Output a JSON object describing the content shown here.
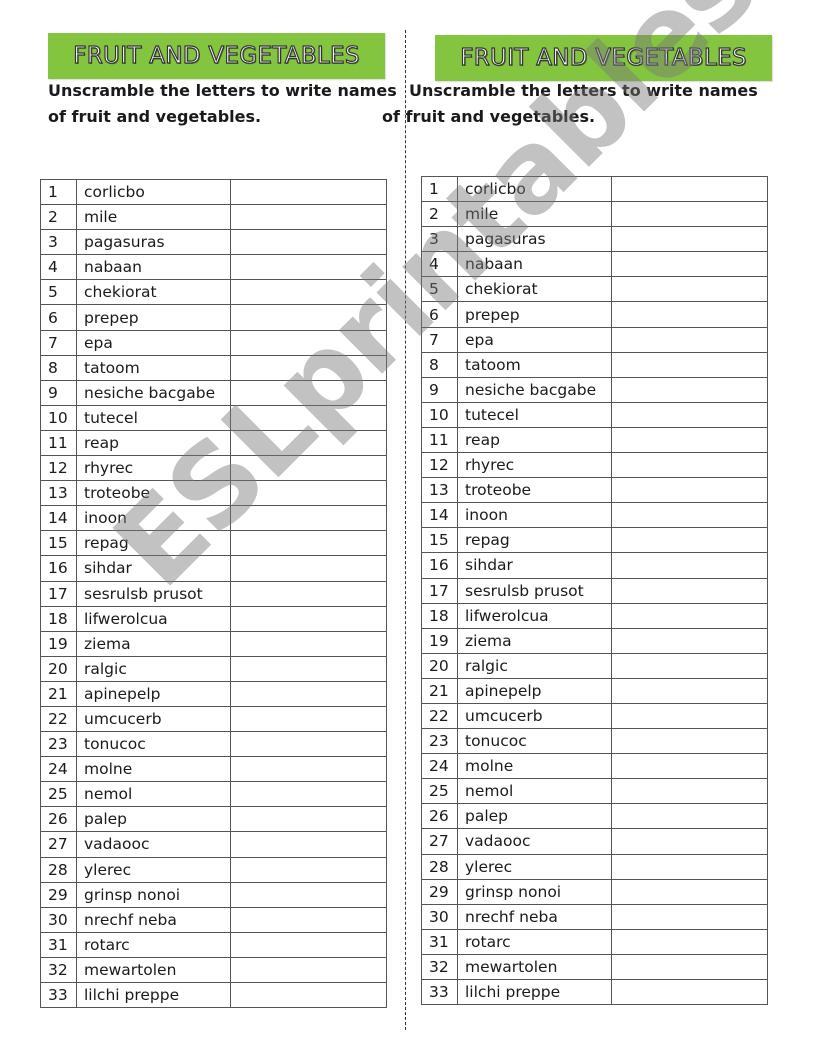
{
  "worksheet": {
    "title": "FRUIT AND VEGETABLES",
    "instruction_line1": "Unscramble the letters to write names",
    "instruction_line2": "of fruit and vegetables.",
    "accent_color": "#84c53f",
    "watermark": "ESLprintables.com",
    "items": [
      {
        "num": "1",
        "word": "corlicbo"
      },
      {
        "num": "2",
        "word": "mile"
      },
      {
        "num": "3",
        "word": "pagasuras"
      },
      {
        "num": "4",
        "word": "nabaan"
      },
      {
        "num": "5",
        "word": "chekiorat"
      },
      {
        "num": "6",
        "word": "prepep"
      },
      {
        "num": "7",
        "word": "epa"
      },
      {
        "num": "8",
        "word": "tatoom"
      },
      {
        "num": "9",
        "word": "nesiche bacgabe"
      },
      {
        "num": "10",
        "word": "tutecel"
      },
      {
        "num": "11",
        "word": "reap"
      },
      {
        "num": "12",
        "word": "rhyrec"
      },
      {
        "num": "13",
        "word": "troteobe"
      },
      {
        "num": "14",
        "word": "inoon"
      },
      {
        "num": "15",
        "word": "repag"
      },
      {
        "num": "16",
        "word": "sihdar"
      },
      {
        "num": "17",
        "word": "sesrulsb prusot"
      },
      {
        "num": "18",
        "word": "lifwerolcua"
      },
      {
        "num": "19",
        "word": "ziema"
      },
      {
        "num": "20",
        "word": "ralgic"
      },
      {
        "num": "21",
        "word": "apinepelp"
      },
      {
        "num": "22",
        "word": "umcucerb"
      },
      {
        "num": "23",
        "word": "tonucoc"
      },
      {
        "num": "24",
        "word": "molne"
      },
      {
        "num": "25",
        "word": "nemol"
      },
      {
        "num": "26",
        "word": "palep"
      },
      {
        "num": "27",
        "word": "vadaooc"
      },
      {
        "num": "28",
        "word": "ylerec"
      },
      {
        "num": "29",
        "word": "grinsp nonoi"
      },
      {
        "num": "30",
        "word": "nrechf neba"
      },
      {
        "num": "31",
        "word": "rotarc"
      },
      {
        "num": "32",
        "word": "mewartolen"
      },
      {
        "num": "33",
        "word": "lilchi preppe"
      }
    ]
  }
}
